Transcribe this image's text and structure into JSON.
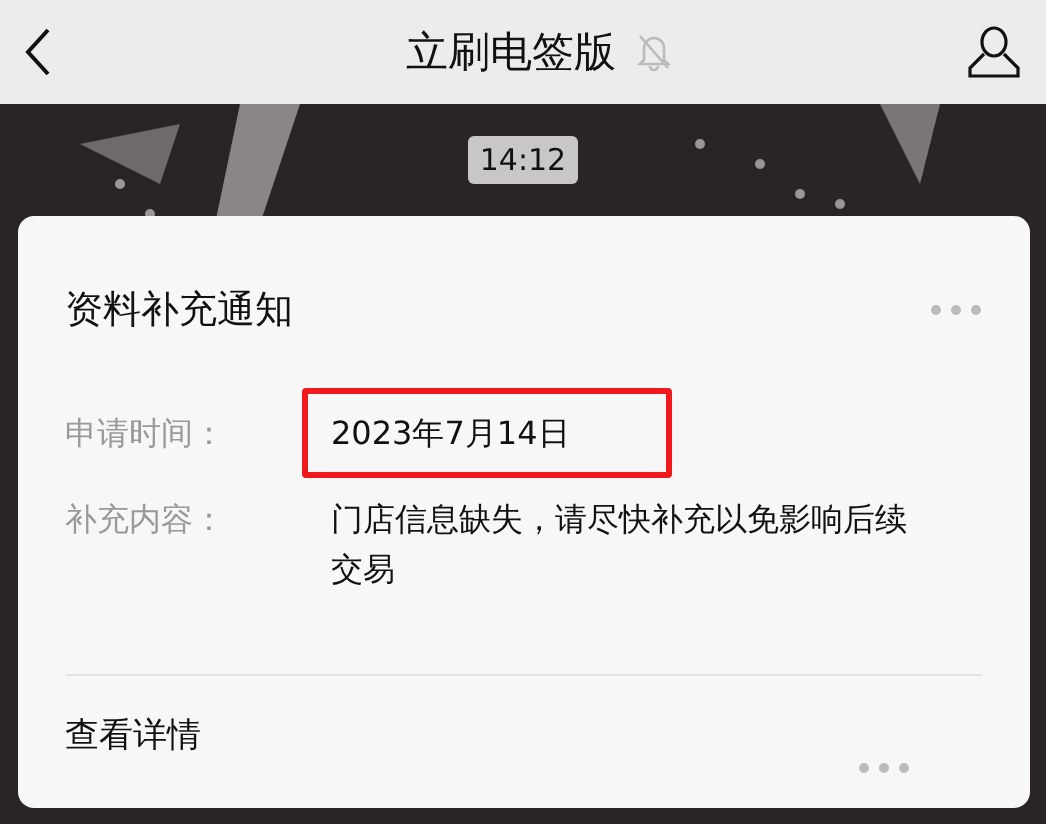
{
  "header": {
    "title": "立刷电签版",
    "muted": true
  },
  "chat": {
    "timestamp": "14:12",
    "card": {
      "title": "资料补充通知",
      "fields": [
        {
          "label": "申请时间：",
          "value": "2023年7月14日",
          "highlighted": true
        },
        {
          "label": "补充内容：",
          "value": "门店信息缺失，请尽快补充以免影响后续交易",
          "highlighted": false
        }
      ],
      "link": "查看详情"
    }
  }
}
